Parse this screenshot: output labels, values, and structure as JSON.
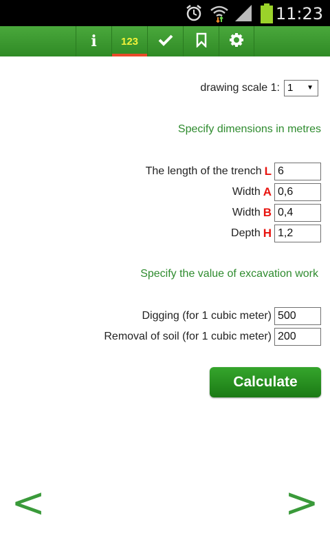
{
  "status_bar": {
    "time": "11:23",
    "icons": [
      "alarm-icon",
      "wifi-icon",
      "signal-icon",
      "battery-icon"
    ]
  },
  "toolbar": {
    "tabs": [
      {
        "name": "info",
        "icon": "info-icon",
        "label": "i"
      },
      {
        "name": "numbers",
        "icon": "numbers-icon",
        "label": "123",
        "active": true
      },
      {
        "name": "check",
        "icon": "check-icon",
        "label": "✔"
      },
      {
        "name": "bookmark",
        "icon": "bookmark-icon",
        "label": ""
      },
      {
        "name": "settings",
        "icon": "gear-icon",
        "label": "⚙"
      }
    ],
    "active_color": "#e84a2a",
    "bar_color": "#3c9a30"
  },
  "scale": {
    "label": "drawing scale 1:",
    "value": "1"
  },
  "dimensions": {
    "heading": "Specify dimensions in metres",
    "fields": [
      {
        "label": "The length of the trench",
        "letter": "L",
        "value": "6"
      },
      {
        "label": "Width",
        "letter": "A",
        "value": "0,6"
      },
      {
        "label": "Width",
        "letter": "B",
        "value": "0,4"
      },
      {
        "label": "Depth",
        "letter": "H",
        "value": "1,2"
      }
    ]
  },
  "costs": {
    "heading": "Specify the value of excavation work",
    "fields": [
      {
        "label": "Digging (for 1 cubic meter)",
        "value": "500"
      },
      {
        "label": "Removal of soil (for 1 cubic meter)",
        "value": "200"
      }
    ]
  },
  "calculate_label": "Calculate",
  "nav": {
    "prev": "<",
    "next": ">"
  }
}
